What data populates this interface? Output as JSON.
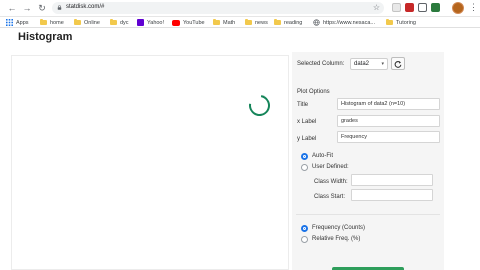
{
  "browser": {
    "url": "statdisk.com/#",
    "bookmarks": [
      {
        "icon": "apps-grid-icon",
        "label": "Apps"
      },
      {
        "icon": "folder-icon",
        "label": "home"
      },
      {
        "icon": "folder-icon",
        "label": "Online"
      },
      {
        "icon": "folder-icon",
        "label": "dyc"
      },
      {
        "icon": "yahoo-icon",
        "label": "Yahoo!"
      },
      {
        "icon": "youtube-icon",
        "label": "YouTube"
      },
      {
        "icon": "folder-icon",
        "label": "Math"
      },
      {
        "icon": "folder-icon",
        "label": "news"
      },
      {
        "icon": "folder-icon",
        "label": "reading"
      },
      {
        "icon": "globe-icon",
        "label": "https://www.nesaca..."
      },
      {
        "icon": "folder-icon",
        "label": "Tutoring"
      }
    ],
    "colors": {
      "yahoo": "#6001d2",
      "youtube": "#ff0000",
      "folder": "#f2c94c"
    }
  },
  "page": {
    "title": "Histogram"
  },
  "controls": {
    "selected_column_label": "Selected Column:",
    "selected_column_value": "data2",
    "plot_options_heading": "Plot Options",
    "title_label": "Title",
    "title_value": "Histogram of data2 (n=10)",
    "xlabel_label": "x Label",
    "xlabel_value": "grades",
    "ylabel_label": "y Label",
    "ylabel_value": "Frequency",
    "auto_fit_label": "Auto-Fit",
    "user_defined_label": "User Defined:",
    "class_width_label": "Class Width:",
    "class_start_label": "Class Start:",
    "frequency_counts_label": "Frequency (Counts)",
    "relative_freq_label": "Relative Freq. (%)"
  },
  "theme": {
    "accent": "#16855a",
    "radio": "#1a73e8",
    "panel_bg": "#f5f5f5"
  }
}
